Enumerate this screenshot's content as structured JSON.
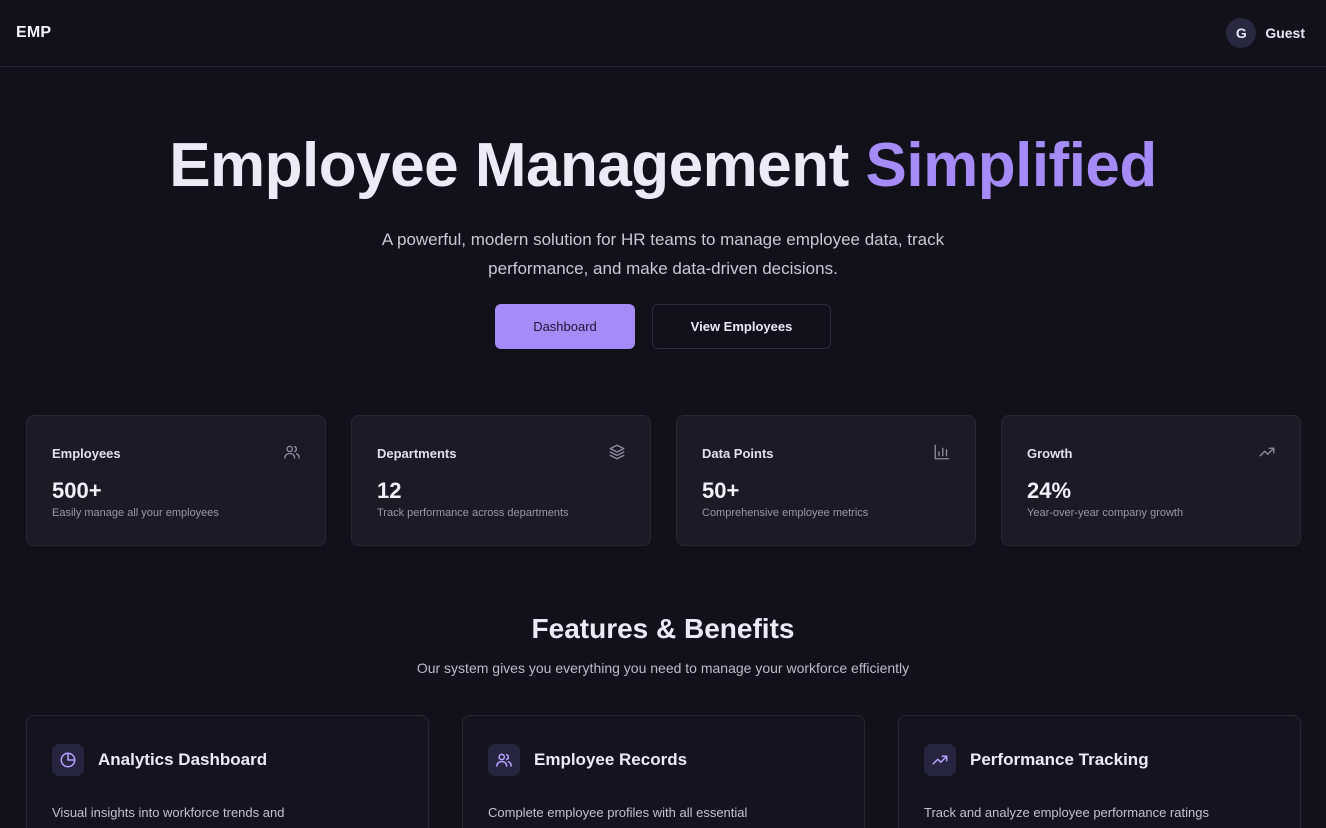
{
  "header": {
    "logo": "EMP",
    "user": {
      "initial": "G",
      "name": "Guest"
    }
  },
  "hero": {
    "title_main": "Employee Management",
    "title_accent": "Simplified",
    "subtitle_line1": "A powerful, modern solution for HR teams to manage employee data, track",
    "subtitle_line2": "performance, and make data-driven decisions.",
    "primary_button": "Dashboard",
    "secondary_button": "View Employees"
  },
  "stats": [
    {
      "label": "Employees",
      "value": "500+",
      "description": "Easily manage all your employees",
      "icon": "users-icon"
    },
    {
      "label": "Departments",
      "value": "12",
      "description": "Track performance across departments",
      "icon": "layers-icon"
    },
    {
      "label": "Data Points",
      "value": "50+",
      "description": "Comprehensive employee metrics",
      "icon": "bar-chart-icon"
    },
    {
      "label": "Growth",
      "value": "24%",
      "description": "Year-over-year company growth",
      "icon": "trending-up-icon"
    }
  ],
  "features_section": {
    "title": "Features & Benefits",
    "subtitle": "Our system gives you everything you need to manage your workforce efficiently"
  },
  "features": [
    {
      "title": "Analytics Dashboard",
      "description": "Visual insights into workforce trends and",
      "icon": "pie-chart-icon"
    },
    {
      "title": "Employee Records",
      "description": "Complete employee profiles with all essential",
      "icon": "users-icon"
    },
    {
      "title": "Performance Tracking",
      "description": "Track and analyze employee performance ratings",
      "icon": "trending-up-icon"
    }
  ],
  "colors": {
    "background": "#121119",
    "accent": "#a48bf7",
    "card": "#1b1a25"
  }
}
